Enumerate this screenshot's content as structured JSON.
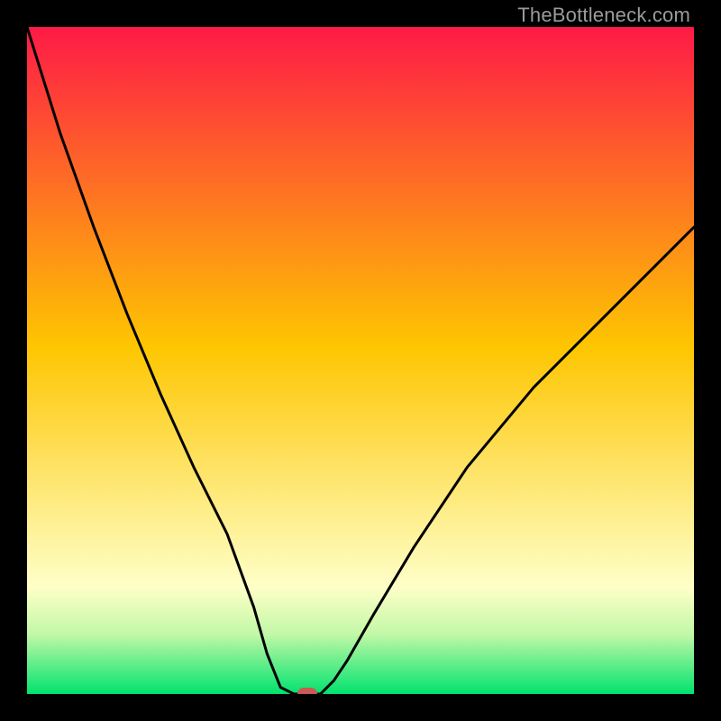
{
  "watermark": "TheBottleneck.com",
  "colors": {
    "top": "#fe1a46",
    "mid": "#fec601",
    "pale": "#feffc8",
    "band": "#c3f8a7",
    "bottom": "#01e36e",
    "curve": "#000000",
    "marker": "#c95a54",
    "frame": "#000000"
  },
  "chart_data": {
    "type": "line",
    "title": "",
    "xlabel": "",
    "ylabel": "",
    "xlim": [
      0,
      100
    ],
    "ylim": [
      0,
      100
    ],
    "left_curve_x": [
      0,
      5,
      10,
      15,
      20,
      25,
      30,
      34,
      36,
      38,
      40
    ],
    "left_curve_y": [
      100,
      84,
      70,
      57,
      45,
      34,
      24,
      13,
      6,
      1,
      0
    ],
    "right_curve_x": [
      44,
      46,
      48,
      52,
      58,
      66,
      76,
      88,
      100
    ],
    "right_curve_y": [
      0,
      2,
      5,
      12,
      22,
      34,
      46,
      58,
      70
    ],
    "flat_segment": {
      "x0": 40,
      "x1": 44,
      "y": 0
    },
    "marker": {
      "x": 42,
      "y": 0
    },
    "gradient_stops": [
      {
        "pct": 0,
        "color": "#fe1a46"
      },
      {
        "pct": 48,
        "color": "#fec601"
      },
      {
        "pct": 84,
        "color": "#feffc8"
      },
      {
        "pct": 91,
        "color": "#c3f8a7"
      },
      {
        "pct": 100,
        "color": "#01e36e"
      }
    ]
  }
}
